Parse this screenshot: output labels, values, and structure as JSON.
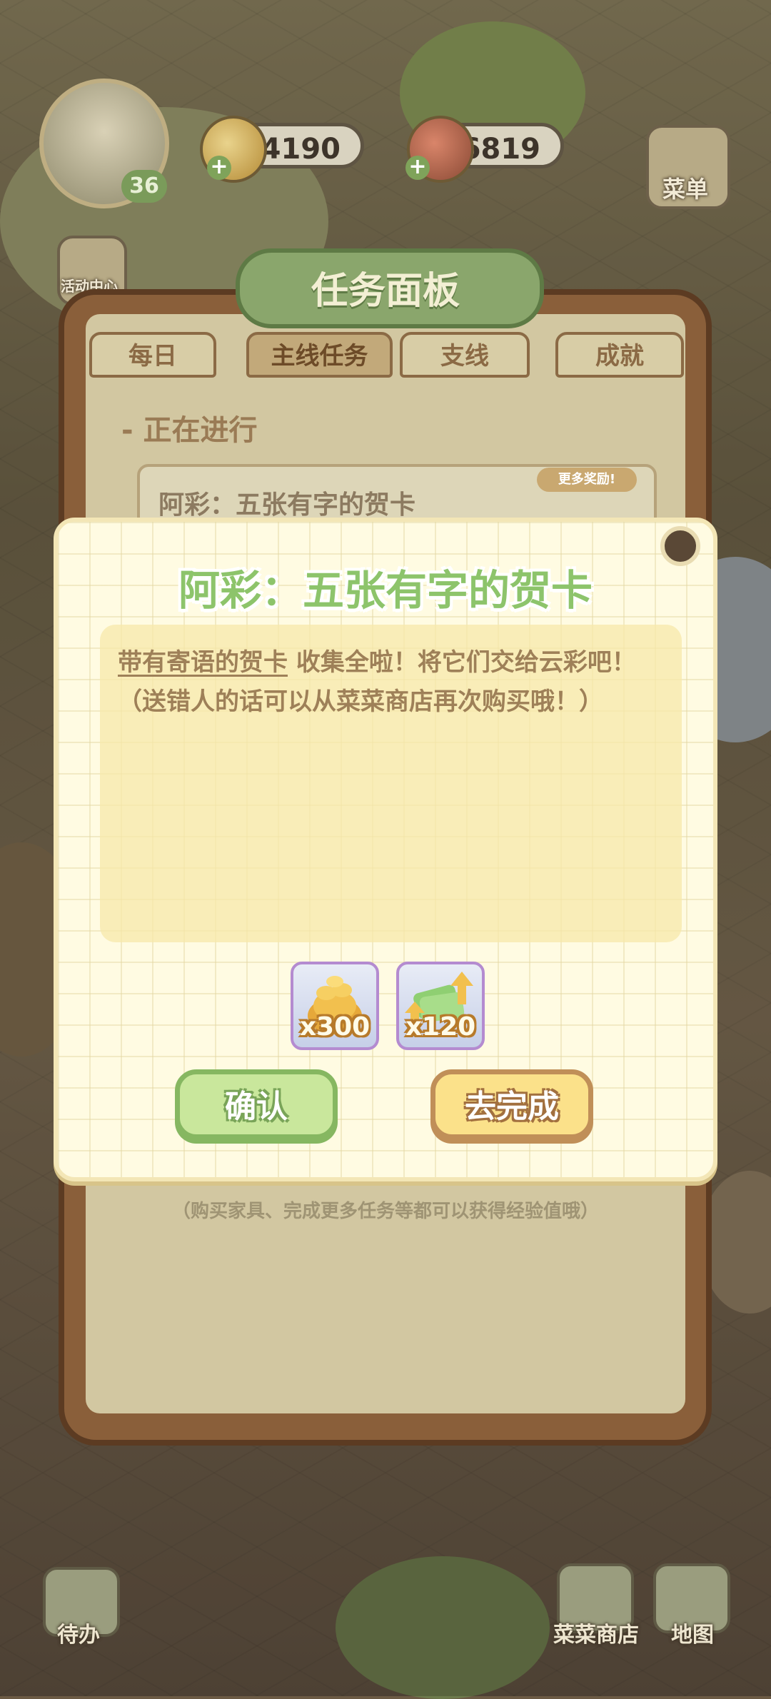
{
  "hud": {
    "level": "36",
    "coins": "24190",
    "carrots": "6819",
    "menu_label": "菜单",
    "event_label": "活动中心"
  },
  "board": {
    "title": "任务面板",
    "tabs": [
      {
        "label": "每日",
        "active": false
      },
      {
        "label": "主线任务",
        "active": true
      },
      {
        "label": "支线",
        "active": false
      },
      {
        "label": "成就",
        "active": false
      }
    ],
    "section_label": "- 正在进行",
    "task_title": "阿彩：五张有字的贺卡",
    "more_rewards": "更多奖励!",
    "hint": "（购买家具、完成更多任务等都可以获得经验值哦）"
  },
  "modal": {
    "title": "阿彩：五张有字的贺卡",
    "line1_item": "带有寄语的贺卡",
    "line1_rest": " 收集全啦！将它们交给云彩吧！",
    "line2": "（送错人的话可以从菜菜商店再次购买哦！）",
    "rewards": [
      {
        "icon": "gold-coins-icon",
        "count": "x300"
      },
      {
        "icon": "green-cash-upgrade-icon",
        "count": "x120"
      }
    ],
    "confirm_label": "确认",
    "go_label": "去完成"
  },
  "bottom_bar": {
    "todo_label": "待办",
    "shop_label": "菜菜商店",
    "map_label": "地图"
  },
  "colors": {
    "title_green": "#8dc46b",
    "confirm_green": "#c9e79c",
    "go_yellow": "#fbe18a",
    "text_brown": "#9e8058"
  }
}
